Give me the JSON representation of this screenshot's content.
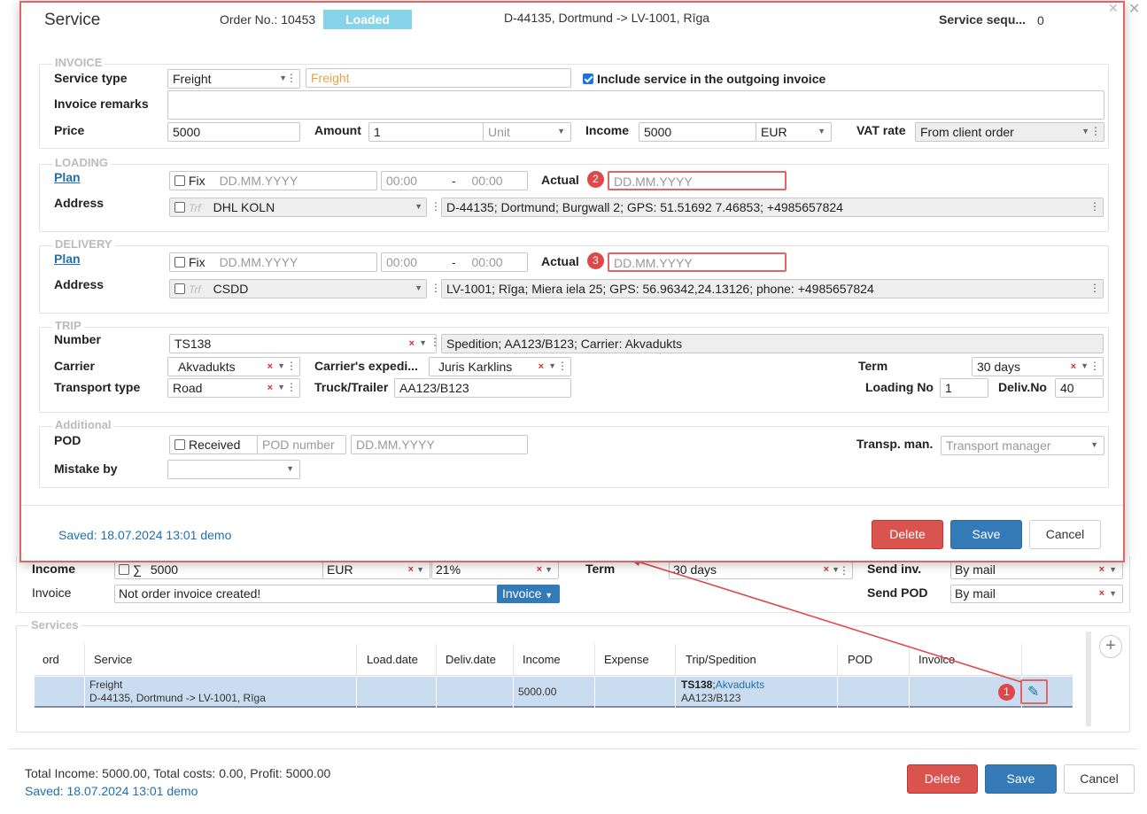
{
  "modal": {
    "title": "Service",
    "order_no": "Order No.: 10453",
    "status": "Loaded",
    "route": "D-44135, Dortmund -> LV-1001, Rīga",
    "service_seq_label": "Service sequ...",
    "service_seq_value": "0",
    "invoice": {
      "title": "INVOICE",
      "service_type_label": "Service type",
      "service_type_value": "Freight",
      "service_name_placeholder": "Freight",
      "include_label": "Include service in the outgoing invoice",
      "remarks_label": "Invoice remarks",
      "price_label": "Price",
      "price_value": "5000",
      "amount_label": "Amount",
      "amount_value": "1",
      "unit_placeholder": "Unit",
      "income_label": "Income",
      "income_value": "5000",
      "currency": "EUR",
      "vat_label": "VAT rate",
      "vat_value": "From client order"
    },
    "loading": {
      "title": "LOADING",
      "plan_label": "Plan",
      "fix_label": "Fix",
      "date_placeholder": "DD.MM.YYYY",
      "time_from": "00:00",
      "time_sep": "-",
      "time_to": "00:00",
      "actual_label": "Actual",
      "actual_placeholder": "DD.MM.YYYY",
      "address_label": "Address",
      "trf_label": "Trf",
      "company": "DHL KOLN",
      "address_value": "D-44135; Dortmund; Burgwall 2; GPS: 51.51692 7.46853; +4985657824"
    },
    "delivery": {
      "title": "DELIVERY",
      "plan_label": "Plan",
      "fix_label": "Fix",
      "date_placeholder": "DD.MM.YYYY",
      "time_from": "00:00",
      "time_sep": "-",
      "time_to": "00:00",
      "actual_label": "Actual",
      "actual_placeholder": "DD.MM.YYYY",
      "address_label": "Address",
      "trf_label": "Trf",
      "company": "CSDD",
      "address_value": "LV-1001; Rīga; Miera iela 25; GPS: 56.96342,24.13126; phone: +4985657824"
    },
    "trip": {
      "title": "TRIP",
      "number_label": "Number",
      "number_value": "TS138",
      "trip_info": "Spedition; AA123/B123; Carrier: Akvadukts",
      "carrier_label": "Carrier",
      "carrier_value": "Akvadukts",
      "expeditor_label": "Carrier's expedi...",
      "expeditor_value": "Juris Karklins",
      "term_label": "Term",
      "term_value": "30 days",
      "transport_type_label": "Transport type",
      "transport_type_value": "Road",
      "truck_label": "Truck/Trailer",
      "truck_value": "AA123/B123",
      "loading_no_label": "Loading No",
      "loading_no_value": "1",
      "deliv_no_label": "Deliv.No",
      "deliv_no_value": "40"
    },
    "additional": {
      "title": "Additional",
      "pod_label": "POD",
      "received_label": "Received",
      "pod_number_placeholder": "POD number",
      "pod_date_placeholder": "DD.MM.YYYY",
      "transp_man_label": "Transp. man.",
      "transp_man_placeholder": "Transport manager",
      "mistake_label": "Mistake by"
    },
    "saved_text": "Saved: 18.07.2024 13:01 demo",
    "delete_label": "Delete",
    "save_label": "Save",
    "cancel_label": "Cancel"
  },
  "background": {
    "income_label": "Income",
    "income_value": "5000",
    "sum_symbol": "∑",
    "income_currency": "EUR",
    "vat_value": "21%",
    "term_label": "Term",
    "term_value": "30 days",
    "send_inv_label": "Send inv.",
    "send_inv_value": "By mail",
    "invoice_label": "Invoice",
    "invoice_value": "Not order invoice created!",
    "invoice_button": "Invoice",
    "send_pod_label": "Send POD",
    "send_pod_value": "By mail",
    "services_title": "Services",
    "table": {
      "headers": [
        "ord",
        "Service",
        "Load.date",
        "Deliv.date",
        "Income",
        "Expense",
        "Trip/Spedition",
        "POD",
        "Invoice"
      ],
      "row": {
        "service_line1": "Freight",
        "service_line2": "D-44135, Dortmund -> LV-1001, Rīga",
        "income": "5000.00",
        "trip_number": "TS138",
        "trip_sep": ";",
        "trip_carrier": "Akvadukts",
        "trip_truck": "AA123/B123"
      }
    },
    "totals": "Total Income: 5000.00, Total costs: 0.00, Profit: 5000.00",
    "saved_text": "Saved: 18.07.2024 13:01 demo",
    "delete_label": "Delete",
    "save_label": "Save",
    "cancel_label": "Cancel"
  },
  "annotations": {
    "badge1": "1",
    "badge2": "2",
    "badge3": "3"
  },
  "colors": {
    "accent": "#337ab7",
    "danger": "#d9534f",
    "status_loaded": "#87d3ea",
    "highlight": "#e06666"
  }
}
